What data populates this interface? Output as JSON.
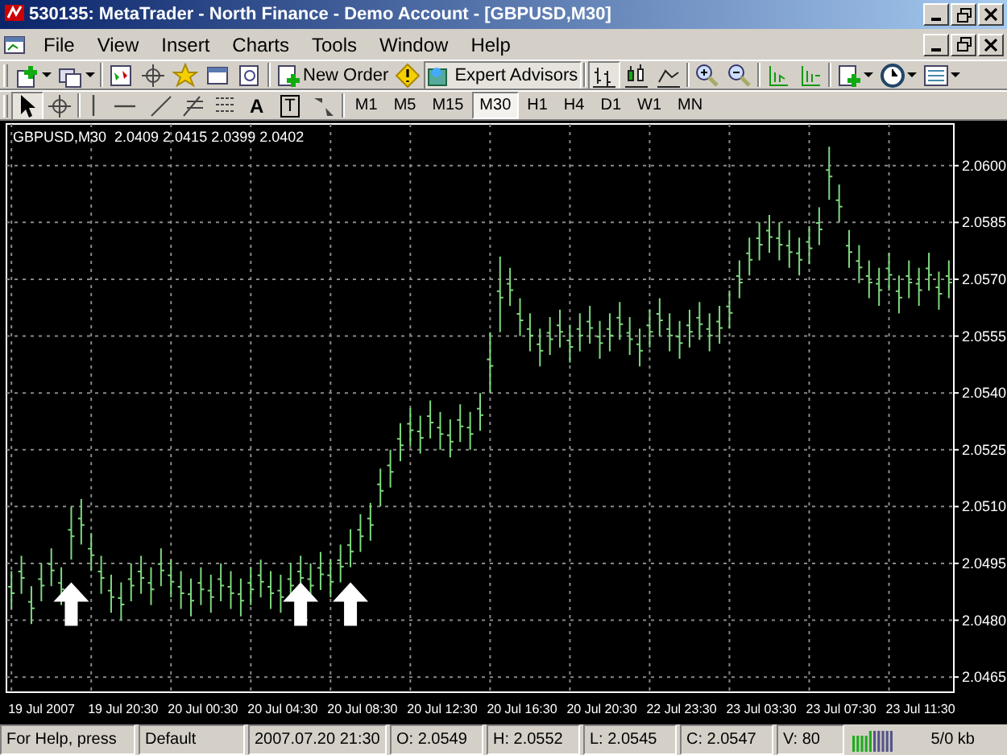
{
  "window": {
    "title": "530135: MetaTrader - North Finance - Demo Account - [GBPUSD,M30]"
  },
  "menu": [
    "File",
    "View",
    "Insert",
    "Charts",
    "Tools",
    "Window",
    "Help"
  ],
  "toolbar": [
    {
      "kind": "new-chart",
      "dropdown": true
    },
    {
      "kind": "profiles",
      "dropdown": true
    },
    {
      "kind": "sep"
    },
    {
      "kind": "market-watch"
    },
    {
      "kind": "crosshair"
    },
    {
      "kind": "star"
    },
    {
      "kind": "window"
    },
    {
      "kind": "magnifier"
    },
    {
      "kind": "sep"
    },
    {
      "kind": "order",
      "label": "New Order"
    },
    {
      "kind": "alert"
    },
    {
      "kind": "experts",
      "label": "Expert Advisors",
      "pressed": true
    },
    {
      "kind": "sep"
    },
    {
      "kind": "bars",
      "pressed": true
    },
    {
      "kind": "candles",
      "pressed": false
    },
    {
      "kind": "line",
      "pressed": false
    },
    {
      "kind": "sep"
    },
    {
      "kind": "zoom-in"
    },
    {
      "kind": "zoom-out"
    },
    {
      "kind": "sep"
    },
    {
      "kind": "shift"
    },
    {
      "kind": "autoscroll"
    },
    {
      "kind": "sep"
    },
    {
      "kind": "indicators",
      "dropdown": true
    },
    {
      "kind": "clock",
      "dropdown": true
    },
    {
      "kind": "templates",
      "dropdown": true
    }
  ],
  "tools": [
    {
      "kind": "cursor",
      "pressed": true
    },
    {
      "kind": "crosshair",
      "pressed": false
    },
    {
      "kind": "sep"
    },
    {
      "kind": "vline",
      "pressed": false
    },
    {
      "kind": "hline",
      "pressed": false
    },
    {
      "kind": "trend",
      "pressed": false
    },
    {
      "kind": "fibo",
      "pressed": false
    },
    {
      "kind": "grid",
      "pressed": false
    },
    {
      "kind": "char",
      "label": "A",
      "pressed": false
    },
    {
      "kind": "boxchar",
      "label": "T",
      "pressed": false
    },
    {
      "kind": "arrows",
      "pressed": false
    }
  ],
  "periods": [
    {
      "label": "M1",
      "selected": false
    },
    {
      "label": "M5",
      "selected": false
    },
    {
      "label": "M15",
      "selected": false
    },
    {
      "label": "M30",
      "selected": true
    },
    {
      "label": "H1",
      "selected": false
    },
    {
      "label": "H4",
      "selected": false
    },
    {
      "label": "D1",
      "selected": false
    },
    {
      "label": "W1",
      "selected": false
    },
    {
      "label": "MN",
      "selected": false
    }
  ],
  "chart": {
    "title": "GBPUSD,M30  2.0409 2.0415 2.0399 2.0402",
    "price_labels": [
      "2.0600",
      "2.0585",
      "2.0570",
      "2.0555",
      "2.0540",
      "2.0525",
      "2.0510",
      "2.0495",
      "2.0480",
      "2.0465"
    ],
    "time_labels": [
      "19 Jul 2007",
      "19 Jul 20:30",
      "20 Jul 00:30",
      "20 Jul 04:30",
      "20 Jul 08:30",
      "20 Jul 12:30",
      "20 Jul 16:30",
      "20 Jul 20:30",
      "22 Jul 23:30",
      "23 Jul 03:30",
      "23 Jul 07:30",
      "23 Jul 11:30"
    ]
  },
  "status_bar": [
    {
      "kind": "text",
      "text": "For Help, press"
    },
    {
      "kind": "text",
      "text": "Default"
    },
    {
      "kind": "text",
      "text": "2007.07.20 21:30"
    },
    {
      "kind": "text",
      "text": "O: 2.0549"
    },
    {
      "kind": "text",
      "text": "H: 2.0552"
    },
    {
      "kind": "text",
      "text": "L: 2.0545"
    },
    {
      "kind": "text",
      "text": "C: 2.0547"
    },
    {
      "kind": "text",
      "text": "V: 80"
    },
    {
      "kind": "signal"
    },
    {
      "kind": "text",
      "text": "5/0 kb"
    }
  ]
}
